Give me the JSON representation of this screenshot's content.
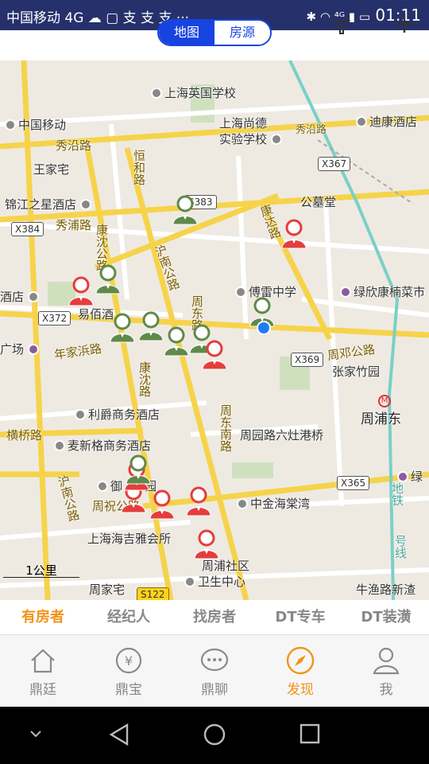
{
  "status": {
    "carrier": "中国移动 4G ☁ ▢ 支 支 支 ···",
    "icons": "✱ ◠ ⁴ᴳ ▮ ▭",
    "time": "01:11"
  },
  "title": {
    "seg_map": "地图",
    "seg_houses": "房源",
    "filter_icon": "filter-icon",
    "add_icon": "plus-icon"
  },
  "map": {
    "labels": {
      "l1": "上海英国学校",
      "l2": "中国移动",
      "l3": "上海尚德",
      "l4": "实验学校",
      "l5": "秀沿路",
      "l6": "迪康酒店",
      "l7": "秀沿路",
      "l8": "王家宅",
      "l9": "恒和路",
      "l10": "X367",
      "l11": "锦江之星酒店",
      "l12": "S383",
      "l13": "公墓堂",
      "l14": "X384",
      "l15": "秀浦路",
      "l16": "康沈公路",
      "l17": "沪南公路",
      "l18": "康达路",
      "l19": "傅雷中学",
      "l20": "绿欣康楠菜市",
      "l21": "酒店",
      "l22": "X372",
      "l23": "易佰酒",
      "l24": "周东路",
      "l25": "年家浜路",
      "l26": "广场",
      "l27": "X369",
      "l28": "周邓公路",
      "l29": "张家竹园",
      "l30": "周浦东",
      "l31": "康沈路",
      "l32": "利爵商务酒店",
      "l33": "周东南路",
      "l34": "横桥路",
      "l35": "麦新格商务酒店",
      "l36": "周园路六灶港桥",
      "l37": "X365",
      "l38": "沪南公路",
      "l39": "御",
      "l40": "园",
      "l41": "周祝公路",
      "l42": "中金海棠湾",
      "l43": "地铁",
      "l44": "号线",
      "l45": "上海海吉雅会所",
      "l46": "周浦社区",
      "l47": "卫生中心",
      "l48": "周家宅",
      "l49": "S122",
      "l50": "牛渔路新渣",
      "l51": "绿"
    },
    "scale": "1公里",
    "markers": [
      {
        "kind": "agent"
      },
      {
        "kind": "owner"
      },
      {
        "kind": "agent"
      },
      {
        "kind": "owner"
      },
      {
        "kind": "agent"
      },
      {
        "kind": "agent"
      },
      {
        "kind": "agent"
      },
      {
        "kind": "agent"
      },
      {
        "kind": "owner"
      },
      {
        "kind": "agent"
      },
      {
        "kind": "owner"
      },
      {
        "kind": "owner"
      },
      {
        "kind": "owner"
      },
      {
        "kind": "owner"
      },
      {
        "kind": "owner"
      },
      {
        "kind": "agent"
      }
    ]
  },
  "categories": [
    "有房者",
    "经纪人",
    "找房者",
    "DT专车",
    "DT装潢"
  ],
  "active_category": 0,
  "tabs": [
    {
      "label": "鼎廷",
      "icon": "home-icon"
    },
    {
      "label": "鼎宝",
      "icon": "wallet-icon"
    },
    {
      "label": "鼎聊",
      "icon": "chat-icon"
    },
    {
      "label": "发现",
      "icon": "compass-icon"
    },
    {
      "label": "我",
      "icon": "profile-icon"
    }
  ],
  "active_tab": 3,
  "colors": {
    "accent": "#f29318",
    "brand": "#1744e0",
    "owner": "#e53d3d",
    "agent": "#5e8a4a"
  }
}
